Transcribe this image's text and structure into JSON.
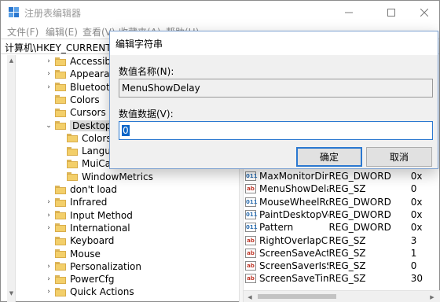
{
  "window": {
    "title": "注册表编辑器",
    "menu": [
      "文件(F)",
      "编辑(E)",
      "查看(V)",
      "收藏夹(A)",
      "帮助(H)"
    ],
    "address": "计算机\\HKEY_CURRENT_USER\\Control Panel\\Desktop"
  },
  "tree": [
    {
      "label": "Accessibility",
      "expander": ">",
      "level": 1
    },
    {
      "label": "Appearance",
      "expander": ">",
      "level": 1
    },
    {
      "label": "Bluetooth",
      "expander": ">",
      "level": 1
    },
    {
      "label": "Colors",
      "expander": "",
      "level": 1
    },
    {
      "label": "Cursors",
      "expander": "",
      "level": 1
    },
    {
      "label": "Desktop",
      "expander": "v",
      "level": 1,
      "selected": true
    },
    {
      "label": "Colors",
      "expander": "",
      "level": 2
    },
    {
      "label": "LanguageConfiguration",
      "expander": "",
      "level": 2
    },
    {
      "label": "MuiCached",
      "expander": "",
      "level": 2
    },
    {
      "label": "WindowMetrics",
      "expander": "",
      "level": 2
    },
    {
      "label": "don't load",
      "expander": "",
      "level": 1
    },
    {
      "label": "Infrared",
      "expander": ">",
      "level": 1
    },
    {
      "label": "Input Method",
      "expander": ">",
      "level": 1
    },
    {
      "label": "International",
      "expander": ">",
      "level": 1
    },
    {
      "label": "Keyboard",
      "expander": "",
      "level": 1
    },
    {
      "label": "Mouse",
      "expander": "",
      "level": 1
    },
    {
      "label": "Personalization",
      "expander": ">",
      "level": 1
    },
    {
      "label": "PowerCfg",
      "expander": ">",
      "level": 1
    },
    {
      "label": "Quick Actions",
      "expander": ">",
      "level": 1
    }
  ],
  "values": [
    {
      "name": "MaxMonitorDimension",
      "type": "REG_DWORD",
      "data": "0x",
      "icon": "dword"
    },
    {
      "name": "MenuShowDelay",
      "type": "REG_SZ",
      "data": "0",
      "icon": "sz"
    },
    {
      "name": "MouseWheelRouting",
      "type": "REG_DWORD",
      "data": "0x",
      "icon": "dword"
    },
    {
      "name": "PaintDesktopVersion",
      "type": "REG_DWORD",
      "data": "0x",
      "icon": "dword"
    },
    {
      "name": "Pattern",
      "type": "REG_DWORD",
      "data": "0x",
      "icon": "dword"
    },
    {
      "name": "RightOverlapChars",
      "type": "REG_SZ",
      "data": "3",
      "icon": "sz"
    },
    {
      "name": "ScreenSaveActive",
      "type": "REG_SZ",
      "data": "1",
      "icon": "sz"
    },
    {
      "name": "ScreenSaverIsSecure",
      "type": "REG_SZ",
      "data": "0",
      "icon": "sz"
    },
    {
      "name": "ScreenSaveTimeOut",
      "type": "REG_SZ",
      "data": "30",
      "icon": "sz"
    }
  ],
  "dialog": {
    "title": "编辑字符串",
    "name_label": "数值名称(N):",
    "name_value": "MenuShowDelay",
    "data_label": "数值数据(V):",
    "data_value": "0",
    "ok": "确定",
    "cancel": "取消"
  },
  "colors": {
    "accent": "#2b78d0",
    "selection": "#0a64c8",
    "folder": "#f3cf6a"
  }
}
